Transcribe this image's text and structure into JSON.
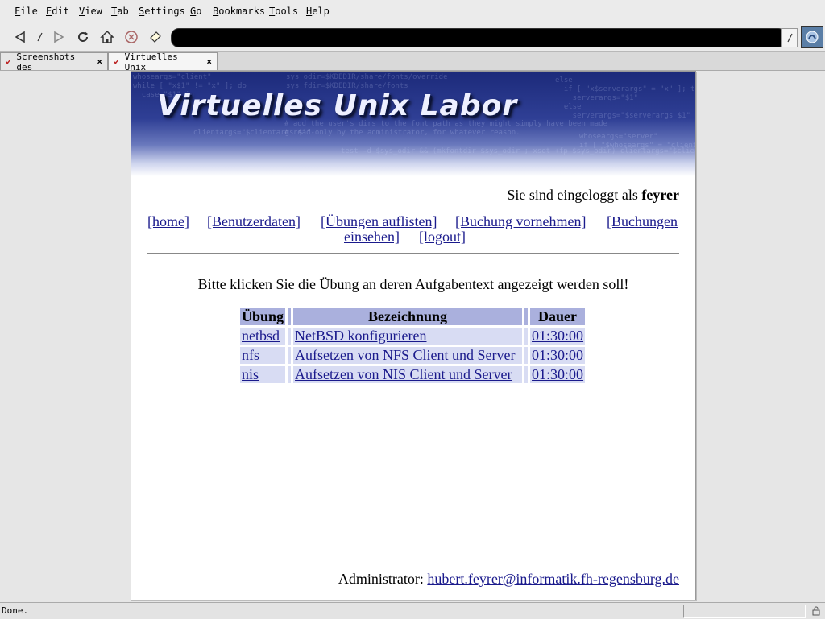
{
  "menu": [
    "File",
    "Edit",
    "View",
    "Tab",
    "Settings",
    "Go",
    "Bookmarks",
    "Tools",
    "Help"
  ],
  "menu_accel": [
    "F",
    "E",
    "V",
    "T",
    "S",
    "G",
    "B",
    "T",
    "H"
  ],
  "toolbar": {
    "icons": [
      "back-icon",
      "stop-slash-icon",
      "forward-icon",
      "reload-icon",
      "home-icon",
      "stop-icon",
      "bookmark-icon"
    ],
    "url": ""
  },
  "tabs": [
    {
      "label": "Screenshots des"
    },
    {
      "label": "Virtuelles Unix"
    }
  ],
  "page": {
    "banner_title": "Virtuelles Unix Labor",
    "banner_code_lines": [
      "whoseargs=\"client\"",
      "while [ \"x$1\" != \"x\" ]; do",
      "  case \"$1\" in",
      "sys_odir=$KDEDIR/share/fonts/override",
      "sys_fdir=$KDEDIR/share/fonts",
      "# add the user's dirs to the font path as they might simply have been made",
      "# read-only by the administrator, for whatever reason.",
      "  clientargs=\"$clientargs $1\"",
      "test -d $sys_odir && (mkfontdir $sys_odir ; xset +fp $sys_odir) clientargs=\"$clientargs $1\"",
      "else",
      "  if [ \"x$serverargs\" = \"x\" ]; then",
      "    serverargs=\"$1\"",
      "  else",
      "    serverargs=\"$serverargs $1\"",
      "whoseargs=\"server\"",
      "if [ \"$whoseargs\" = \"client\" ]; then"
    ],
    "login_prefix": "Sie sind eingeloggt als",
    "login_user": "feyrer",
    "nav": [
      "[home]",
      "[Benutzerdaten]",
      "[Übungen auflisten]",
      "[Buchung vornehmen]",
      "[Buchungen",
      "einsehen]",
      "[logout]"
    ],
    "prompt": "Bitte klicken Sie die Übung an deren Aufgabentext angezeigt werden soll!",
    "table": {
      "headers": [
        "Übung",
        "Bezeichnung",
        "Dauer"
      ],
      "rows": [
        [
          "netbsd",
          "NetBSD konfigurieren",
          "01:30:00"
        ],
        [
          "nfs",
          "Aufsetzen von NFS Client und Server",
          "01:30:00"
        ],
        [
          "nis",
          "Aufsetzen von NIS Client und Server",
          "01:30:00"
        ]
      ]
    },
    "admin_label": "Administrator:",
    "admin_email": "hubert.feyrer@informatik.fh-regensburg.de"
  },
  "status": {
    "text": "Done."
  }
}
